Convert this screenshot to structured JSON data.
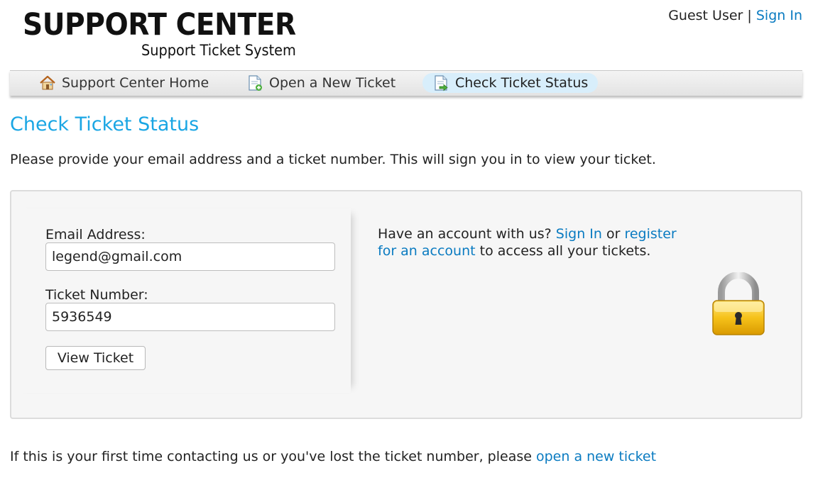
{
  "header": {
    "logo_title": "SUPPORT CENTER",
    "logo_subtitle": "Support Ticket System",
    "user_label": "Guest User",
    "separator": "|",
    "sign_in_link": "Sign In"
  },
  "nav": {
    "items": [
      {
        "label": "Support Center Home",
        "icon": "home-icon",
        "active": false
      },
      {
        "label": "Open a New Ticket",
        "icon": "new-ticket-icon",
        "active": false
      },
      {
        "label": "Check Ticket Status",
        "icon": "ticket-status-icon",
        "active": true
      }
    ]
  },
  "page": {
    "title": "Check Ticket Status",
    "intro": "Please provide your email address and a ticket number. This will sign you in to view your ticket."
  },
  "form": {
    "email_label": "Email Address:",
    "email_value": "legend@gmail.com",
    "ticket_label": "Ticket Number:",
    "ticket_value": "5936549",
    "submit_label": "View Ticket"
  },
  "account": {
    "prefix": "Have an account with us?",
    "sign_in_link": "Sign In",
    "or": "or",
    "register_link": "register for an account",
    "suffix": "to access all your tickets.",
    "icon": "lock-icon"
  },
  "footer": {
    "note": "If this is your first time contacting us or you've lost the ticket number, please",
    "new_ticket_link": "open a new ticket"
  },
  "colors": {
    "accent": "#1aa6e4",
    "link": "#0a7bc1",
    "nav_active": "#d8eefb",
    "panel_bg": "#f6f6f6"
  }
}
